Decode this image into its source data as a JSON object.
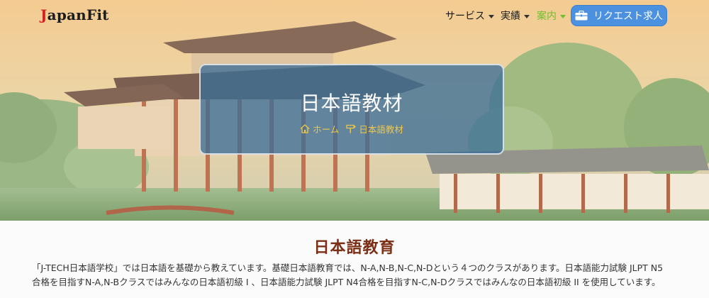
{
  "header": {
    "logo_initial": "J",
    "logo_rest": "apanFit",
    "nav": [
      {
        "label": "サービス",
        "has_caret": true
      },
      {
        "label": "実績",
        "has_caret": true
      },
      {
        "label": "案内",
        "has_caret": true,
        "active": true
      }
    ],
    "request_button": {
      "label": "リクエスト求人",
      "icon": "briefcase-icon"
    }
  },
  "hero": {
    "title": "日本語教材",
    "breadcrumb": {
      "home_icon": "home-icon",
      "home_label": "ホーム",
      "current_icon": "signpost-icon",
      "current_label": "日本語教材"
    }
  },
  "main": {
    "section_title": "日本語教育",
    "paragraph_line1": "「J-TECH日本語学校」では日本語を基礎から教えています。基礎日本語教育では、N-A,N-B,N-C,N-Dという４つのクラスがあります。日本語能力試験 JLPT N5",
    "paragraph_line2": "合格を目指すN-A,N-Bクラスではみんなの日本語初級 I 、日本語能力試験 JLPT N4合格を目指すN-C,N-Dクラスではみんなの日本語初級 II を使用しています。"
  },
  "colors": {
    "accent_blue": "#4b91e0",
    "active_green": "#6fbf2e",
    "section_title": "#7a2f16",
    "breadcrumb_gold": "#f0c848"
  }
}
